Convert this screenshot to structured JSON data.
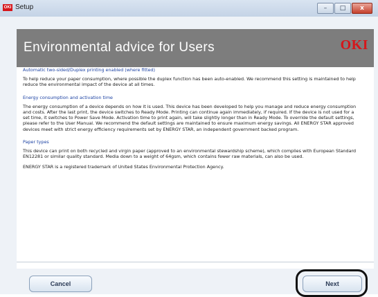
{
  "window": {
    "icon_text": "OKI",
    "title": "Setup",
    "buttons": {
      "minimize": "–",
      "maximize": "□",
      "close": "x"
    }
  },
  "banner": {
    "title": "Environmental advice for Users",
    "logo": "OKI"
  },
  "sections": [
    {
      "heading": "Automatic two-sided/Duplex printing enabled (where fitted)",
      "paragraphs": [
        "To help reduce your paper consumption, where possible the duplex function has been auto-enabled. We recommend this setting is maintained to help reduce the environmental impact of the device at all times."
      ]
    },
    {
      "heading": "Energy consumption and activation time",
      "paragraphs": [
        "The energy consumption of a device depends on how it is used. This device has been developed to help you manage and reduce energy consumption and costs. After the last print, the device switches to Ready Mode. Printing can continue again immediately, if required. If the device is not used for a set time, it switches to Power Save Mode. Activation time to print again, will take slightly longer than in Ready Mode. To override the default settings, please refer to the User Manual. We recommend the default settings are maintained to ensure maximum energy savings. All ENERGY STAR approved devices meet with strict energy efficiency requirements set by ENERGY STAR, an independent government backed program."
      ]
    },
    {
      "heading": "Paper types",
      "paragraphs": [
        "This device can print on both recycled and virgin paper (approved to an environmental stewardship scheme), which complies with European Standard EN12281 or similar quality standard. Media down to a weight of 64gsm, which contains fewer raw materials, can also be used.",
        "ENERGY STAR is a registered trademark of United States Environmental Protection Agency."
      ]
    }
  ],
  "footer": {
    "cancel_label": "Cancel",
    "next_label": "Next"
  },
  "colors": {
    "banner_bg": "#7d7d7d",
    "logo_red": "#d6161b",
    "heading_blue": "#1c42a3"
  }
}
